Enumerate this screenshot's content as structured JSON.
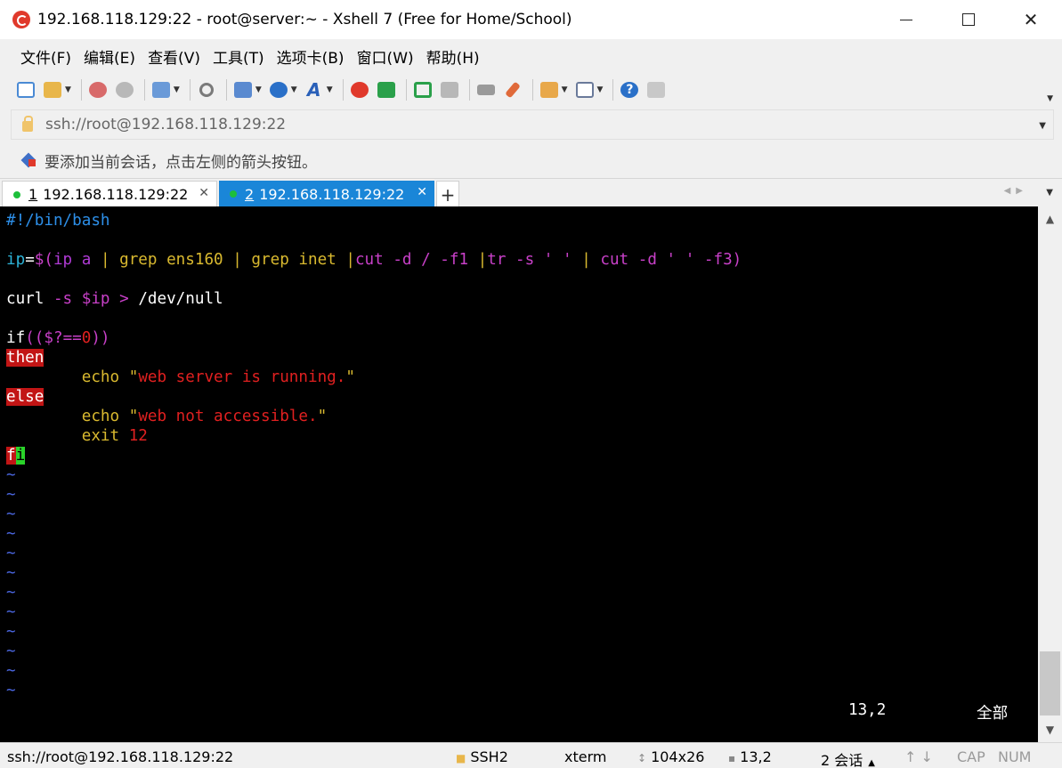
{
  "window": {
    "title": "192.168.118.129:22 - root@server:~ - Xshell 7 (Free for Home/School)"
  },
  "menu": [
    "文件(F)",
    "编辑(E)",
    "查看(V)",
    "工具(T)",
    "选项卡(B)",
    "窗口(W)",
    "帮助(H)"
  ],
  "address": {
    "value": "ssh://root@192.168.118.129:22"
  },
  "hint": {
    "text": "要添加当前会话，点击左侧的箭头按钮。"
  },
  "tabs": [
    {
      "num": "1",
      "label": "192.168.118.129:22"
    },
    {
      "num": "2",
      "label": "192.168.118.129:22"
    }
  ],
  "tab_add": "+",
  "terminal": {
    "shebang": "#!/bin/bash",
    "line_ip": {
      "var": "ip",
      "eq": "=",
      "open": "$(",
      "ip": "ip a ",
      "pipe1": "| ",
      "grep1": "grep ens160 ",
      "pipe2": "| ",
      "grep2": "grep inet ",
      "pipe3": "|",
      "cut1": "cut -d / -f1 ",
      "pipe4": "|",
      "tr": "tr -s ' ' ",
      "pipe5": "| ",
      "cut2": "cut -d ' ' -f3",
      "close": ")"
    },
    "line_curl": {
      "cmd": "curl ",
      "opt": "-s ",
      "var": "$ip",
      "redir": " > ",
      "path": "/dev/null"
    },
    "line_if": {
      "kw": "if",
      "open": "((",
      "var": "$?",
      "op": "==",
      "num": "0",
      "close": "))"
    },
    "kw_then": "then",
    "line_echo1": {
      "indent": "        ",
      "cmd": "echo ",
      "q1": "\"",
      "str": "web server is running.",
      "q2": "\""
    },
    "kw_else": "else",
    "line_echo2": {
      "indent": "        ",
      "cmd": "echo ",
      "q1": "\"",
      "str": "web not accessible.",
      "q2": "\""
    },
    "line_exit": {
      "indent": "        ",
      "cmd": "exit ",
      "num": "12"
    },
    "kw_fi_f": "f",
    "kw_fi_i": "i",
    "tilde": "~",
    "cursor_pos": "13,2",
    "view_all": "全部"
  },
  "statusbar": {
    "connection": "ssh://root@192.168.118.129:22",
    "protocol": "SSH2",
    "terminal_type": "xterm",
    "size": "104x26",
    "position": "13,2",
    "sessions": "2 会话",
    "cap": "CAP",
    "num": "NUM"
  },
  "colors": {
    "tab_active": "#1a86d8",
    "keyword_highlight": "#c21515",
    "cursor": "#2ad42a",
    "terminal_bg": "#000000"
  }
}
